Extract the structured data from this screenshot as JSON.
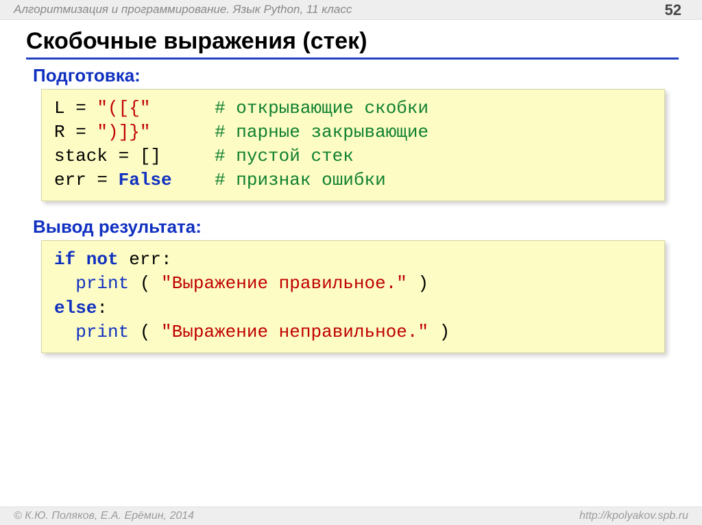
{
  "header": {
    "course": "Алгоритмизация и программирование. Язык Python, 11 класс",
    "page": "52"
  },
  "title": "Скобочные выражения (стек)",
  "section1": "Подготовка:",
  "code1": {
    "l1a": "L",
    "l1b": " = ",
    "l1c": "\"([{\"",
    "l1pad": "      ",
    "l1d": "# открывающие скобки",
    "l2a": "R",
    "l2b": " = ",
    "l2c": "\")]}\"",
    "l2pad": "      ",
    "l2d": "# парные закрывающие",
    "l3a": "stack",
    "l3b": " = []",
    "l3pad": "     ",
    "l3d": "# пустой стек",
    "l4a": "err",
    "l4b": " = ",
    "l4c": "False",
    "l4pad": "    ",
    "l4d": "# признак ошибки"
  },
  "section2": "Вывод результата:",
  "code2": {
    "l1a": "if not",
    "l1b": " err:",
    "l2a": "  ",
    "l2b": "print",
    "l2c": " ( ",
    "l2d": "\"Выражение правильное.\"",
    "l2e": " )",
    "l3a": "else",
    "l3b": ":",
    "l4a": "  ",
    "l4b": "print",
    "l4c": " ( ",
    "l4d": "\"Выражение неправильное.\"",
    "l4e": " )"
  },
  "footer": {
    "left": "© К.Ю. Поляков, Е.А. Ерёмин, 2014",
    "right": "http://kpolyakov.spb.ru"
  }
}
